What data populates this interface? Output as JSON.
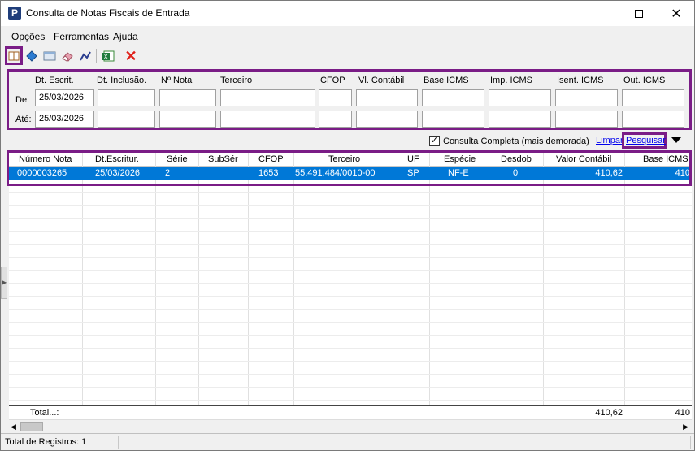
{
  "window": {
    "title": "Consulta de Notas Fiscais de Entrada",
    "icon": "P"
  },
  "menu": [
    "Opções",
    "Ferramentas",
    "Ajuda"
  ],
  "toolbar": {
    "icons": [
      "book-icon",
      "blue-book-icon",
      "window-icon",
      "eraser-icon",
      "chart-tool-icon",
      "excel-icon",
      "close-red-icon"
    ]
  },
  "filters": {
    "row_labels": {
      "from": "De:",
      "to": "Até:"
    },
    "columns": [
      "Dt. Escrit.",
      "Dt. Inclusão.",
      "Nº Nota",
      "Terceiro",
      "CFOP",
      "Vl. Contábil",
      "Base ICMS",
      "Imp. ICMS",
      "Isent. ICMS",
      "Out. ICMS"
    ],
    "from_date": "25/03/2026",
    "to_date": "25/03/2026"
  },
  "options": {
    "full_query_label": "Consulta Completa (mais demorada)",
    "full_query_checked": true,
    "clear_label": "Limpar",
    "search_label": "Pesquisar"
  },
  "grid": {
    "headers": [
      "Número Nota",
      "Dt.Escritur.",
      "Série",
      "SubSér",
      "CFOP",
      "Terceiro",
      "UF",
      "Espécie",
      "Desdob",
      "Valor Contábil",
      "Base ICMS"
    ],
    "rows": [
      [
        "0000003265",
        "25/03/2026",
        "2",
        "",
        "1653",
        "55.491.484/0010-00",
        "SP",
        "NF-E",
        "0",
        "410,62",
        "410"
      ]
    ],
    "total_label": "Total...:",
    "total_valor_contabil": "410,62",
    "total_base_icms": "410"
  },
  "status": {
    "records": "Total de Registros: 1"
  },
  "colors": {
    "highlight": "#7a1c86",
    "selection": "#0078d7"
  }
}
